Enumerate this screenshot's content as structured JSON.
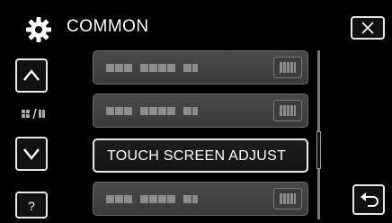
{
  "header": {
    "title": "COMMON",
    "settings_icon": "gear-icon",
    "close_icon": "close-icon"
  },
  "side": {
    "up_icon": "chevron-up-icon",
    "mode_icon": "mode-switch-icon",
    "down_icon": "chevron-down-icon",
    "help_label": "?"
  },
  "menu": {
    "items": [
      {
        "label": "",
        "state": "dimmed"
      },
      {
        "label": "",
        "state": "dimmed"
      },
      {
        "label": "TOUCH SCREEN ADJUST",
        "state": "selected"
      },
      {
        "label": "",
        "state": "dimmed"
      }
    ]
  },
  "footer": {
    "return_icon": "return-arrow-icon"
  },
  "colors": {
    "background": "#000000",
    "button_border": "#e8e8e8",
    "dim_item": "#444444",
    "text": "#ffffff"
  }
}
